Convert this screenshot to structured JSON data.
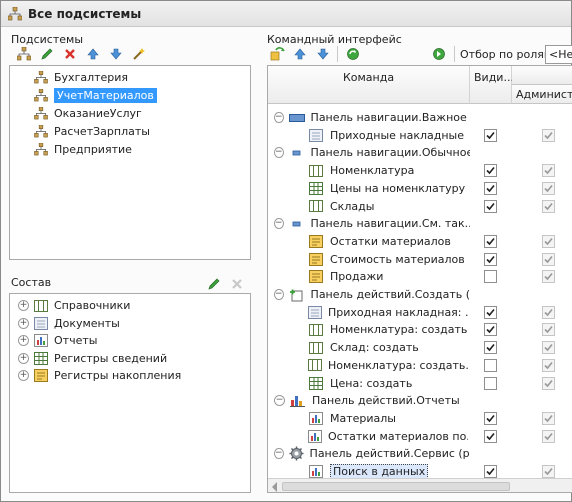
{
  "window": {
    "title": "Все подсистемы"
  },
  "left": {
    "subsystems_label": "Подсистемы",
    "subsystems": [
      {
        "label": "Бухгалтерия",
        "selected": false
      },
      {
        "label": "УчетМатериалов",
        "selected": true
      },
      {
        "label": "ОказаниеУслуг",
        "selected": false
      },
      {
        "label": "РасчетЗарплаты",
        "selected": false
      },
      {
        "label": "Предприятие",
        "selected": false
      }
    ],
    "composition_label": "Состав",
    "composition": [
      {
        "label": "Справочники",
        "icon": "catalog-icon"
      },
      {
        "label": "Документы",
        "icon": "document-icon"
      },
      {
        "label": "Отчеты",
        "icon": "report-icon"
      },
      {
        "label": "Регистры сведений",
        "icon": "info-register-icon"
      },
      {
        "label": "Регистры накопления",
        "icon": "accumulation-register-icon"
      }
    ]
  },
  "right": {
    "label": "Командный интерфейс",
    "role_filter_label": "Отбор по ролям:",
    "role_filter_value": "<Не",
    "columns": {
      "command": "Команда",
      "visibility": "Види...",
      "admin": "Админист..."
    },
    "rows": [
      {
        "type": "group",
        "label": "Панель навигации.Важное (...",
        "icon": "nav-important-icon"
      },
      {
        "type": "item",
        "label": "Приходные накладные",
        "icon": "document-icon",
        "visible": true,
        "admin": true
      },
      {
        "type": "group",
        "label": "Панель навигации.Обычное...",
        "icon": "nav-normal-icon"
      },
      {
        "type": "item",
        "label": "Номенклатура",
        "icon": "catalog-icon",
        "visible": true,
        "admin": true
      },
      {
        "type": "item",
        "label": "Цены на номенклатуру",
        "icon": "info-register-icon",
        "visible": true,
        "admin": true
      },
      {
        "type": "item",
        "label": "Склады",
        "icon": "catalog-icon",
        "visible": true,
        "admin": true
      },
      {
        "type": "group",
        "label": "Панель навигации.См. так...",
        "icon": "nav-see-also-icon"
      },
      {
        "type": "item",
        "label": "Остатки материалов",
        "icon": "accumulation-register-icon",
        "visible": true,
        "admin": true
      },
      {
        "type": "item",
        "label": "Стоимость материалов",
        "icon": "accumulation-register-icon",
        "visible": true,
        "admin": true
      },
      {
        "type": "item",
        "label": "Продажи",
        "icon": "accumulation-register-icon",
        "visible": false,
        "admin": true
      },
      {
        "type": "group",
        "label": "Панель действий.Создать (...",
        "icon": "action-create-icon"
      },
      {
        "type": "item",
        "label": "Приходная накладная: ...",
        "icon": "document-icon",
        "visible": true,
        "admin": true
      },
      {
        "type": "item",
        "label": "Номенклатура: создать",
        "icon": "catalog-icon",
        "visible": true,
        "admin": true
      },
      {
        "type": "item",
        "label": "Склад: создать",
        "icon": "catalog-icon",
        "visible": true,
        "admin": true
      },
      {
        "type": "item",
        "label": "Номенклатура: создать...",
        "icon": "catalog-icon",
        "visible": false,
        "admin": true
      },
      {
        "type": "item",
        "label": "Цена: создать",
        "icon": "info-register-icon",
        "visible": false,
        "admin": true
      },
      {
        "type": "group",
        "label": "Панель действий.Отчеты",
        "icon": "action-reports-icon"
      },
      {
        "type": "item",
        "label": "Материалы",
        "icon": "report-icon",
        "visible": true,
        "admin": true
      },
      {
        "type": "item",
        "label": "Остатки материалов по...",
        "icon": "report-icon",
        "visible": true,
        "admin": true
      },
      {
        "type": "group",
        "label": "Панель действий.Сервис (р...",
        "icon": "action-service-icon"
      },
      {
        "type": "item",
        "label": "Поиск в данных",
        "icon": "report-icon",
        "visible": true,
        "admin": true,
        "selected": true
      }
    ]
  }
}
